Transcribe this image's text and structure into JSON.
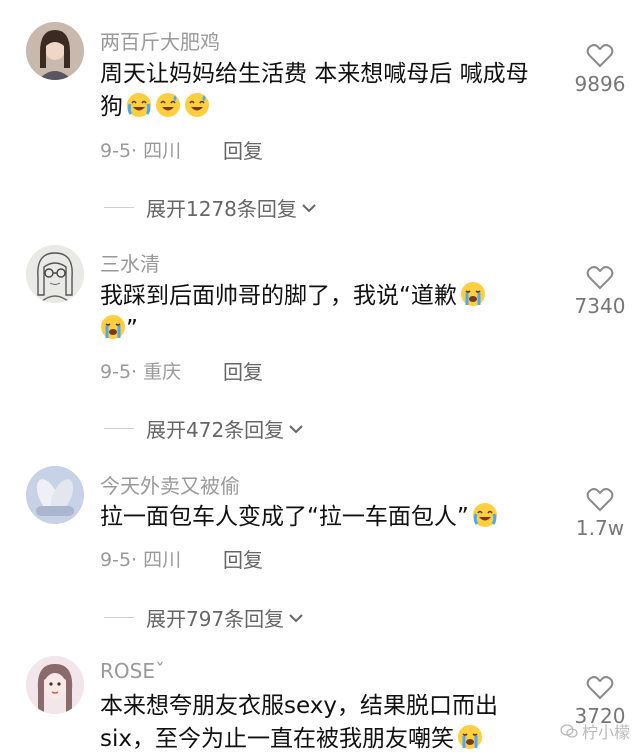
{
  "comments": [
    {
      "username": "两百斤大肥鸡",
      "text": "周天让妈妈给生活费 本来想喊母后 喊成母狗",
      "emojis": [
        "crying-laughing",
        "sweat-laughing",
        "sweat-laughing"
      ],
      "date_location": "9-5· 四川",
      "reply_label": "回复",
      "likes": "9896",
      "expand_label": "展开1278条回复"
    },
    {
      "username": "三水清",
      "text": "我踩到后面帅哥的脚了，我说“道歉",
      "text_tail": "”",
      "emojis": [
        "crying",
        "crying"
      ],
      "date_location": "9-5· 重庆",
      "reply_label": "回复",
      "likes": "7340",
      "expand_label": "展开472条回复"
    },
    {
      "username": "今天外卖又被偷",
      "text": "拉一面包车人变成了“拉一车面包人”",
      "emojis": [
        "crying-laughing"
      ],
      "date_location": "9-5· 四川",
      "reply_label": "回复",
      "likes": "1.7w",
      "expand_label": "展开797条回复"
    },
    {
      "username": "ROSEˇ",
      "text": "本来想夸朋友衣服sexy，结果脱口而出six，至今为止一直在被我朋友嘲笑",
      "emojis": [
        "crying"
      ],
      "likes": "3720"
    }
  ],
  "watermark": "柠小檬",
  "colors": {
    "meta": "#9a9a9a",
    "text": "#111111",
    "emoji_face": "#ffcf3f"
  }
}
